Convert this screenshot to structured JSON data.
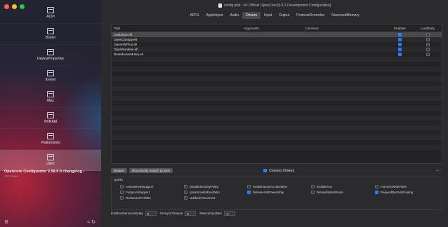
{
  "window": {
    "title": "config.plist - for Official OpenCore [0.8.1 Development Configuration]"
  },
  "sidebar": {
    "items": [
      {
        "label": "ACPI",
        "icon": "list-icon",
        "active": false
      },
      {
        "label": "Booter",
        "icon": "list-icon",
        "active": false
      },
      {
        "label": "DeviceProperties",
        "icon": "list-icon",
        "active": false
      },
      {
        "label": "Kernel",
        "icon": "list-icon",
        "active": false
      },
      {
        "label": "Misc",
        "icon": "list-icon",
        "active": false
      },
      {
        "label": "NVRAM",
        "icon": "list-icon",
        "active": false
      },
      {
        "label": "PlatformInfo",
        "icon": "list-icon",
        "active": false
      },
      {
        "label": "UEFI",
        "icon": "list-icon",
        "active": true
      }
    ],
    "notice_title": "Opencore Configurator 2.58.0.0 changelog -",
    "notice_sub": "Click here",
    "bottom_left": "⚙",
    "bottom_right": "< ↻"
  },
  "tabs": [
    {
      "label": "APFS",
      "selected": false
    },
    {
      "label": "AppleInput",
      "selected": false
    },
    {
      "label": "Audio",
      "selected": false
    },
    {
      "label": "Drivers",
      "selected": true
    },
    {
      "label": "Input",
      "selected": false
    },
    {
      "label": "Output",
      "selected": false
    },
    {
      "label": "ProtocolOverrides",
      "selected": false
    },
    {
      "label": "ReservedMemory",
      "selected": false
    }
  ],
  "table": {
    "headers": {
      "path": "Path",
      "arguments": "Arguments",
      "comment": "Comment",
      "enabled": "Enabled",
      "load_early": "LoadEarly"
    },
    "rows": [
      {
        "path": "AudioDxe.efi",
        "arguments": "",
        "comment": "",
        "enabled": true,
        "load_early": false,
        "selected": true
      },
      {
        "path": "OpenCanopy.efi",
        "arguments": "",
        "comment": "",
        "enabled": true,
        "load_early": false,
        "selected": false
      },
      {
        "path": "OpenHfsPlus.efi",
        "arguments": "",
        "comment": "",
        "enabled": true,
        "load_early": false,
        "selected": false
      },
      {
        "path": "OpenRuntime.efi",
        "arguments": "",
        "comment": "",
        "enabled": true,
        "load_early": false,
        "selected": false
      },
      {
        "path": "ResetNvramEntry.efi",
        "arguments": "",
        "comment": "",
        "enabled": true,
        "load_early": false,
        "selected": false
      }
    ]
  },
  "buttons": {
    "browse": "Browse",
    "recursive": "Recursively Search Drivers",
    "connect_drivers": "Connect Drivers",
    "connect_checked": true,
    "plus_minus": "+ −"
  },
  "quirks": {
    "title": "Quirks",
    "columns": [
      [
        {
          "label": "ActivateHpetSupport",
          "checked": false
        },
        {
          "label": "ForgeUefiSupport",
          "checked": false
        },
        {
          "label": "ResizeUsePciRbIo",
          "checked": false
        }
      ],
      [
        {
          "label": "DisableSecurityPolicy",
          "checked": false
        },
        {
          "label": "IgnoreInvalidFlexRatio",
          "checked": false
        },
        {
          "label": "UnblockFsConnect",
          "checked": false
        }
      ],
      [
        {
          "label": "EnableVectorAcceleration",
          "checked": false
        },
        {
          "label": "ReleaseUsbOwnership",
          "checked": true
        }
      ],
      [
        {
          "label": "EnableVmx",
          "checked": false
        },
        {
          "label": "ReloadOptionRoms",
          "checked": false
        }
      ],
      [
        {
          "label": "ForceOcWriteFlash",
          "checked": false
        },
        {
          "label": "RequestBootVarRouting",
          "checked": true
        }
      ]
    ]
  },
  "fields": [
    {
      "label": "ExitBootServicesDelay",
      "value": "0"
    },
    {
      "label": "TscSyncTimeout",
      "value": "0"
    },
    {
      "label": "ResizeGpuBars",
      "value": "-1"
    }
  ]
}
